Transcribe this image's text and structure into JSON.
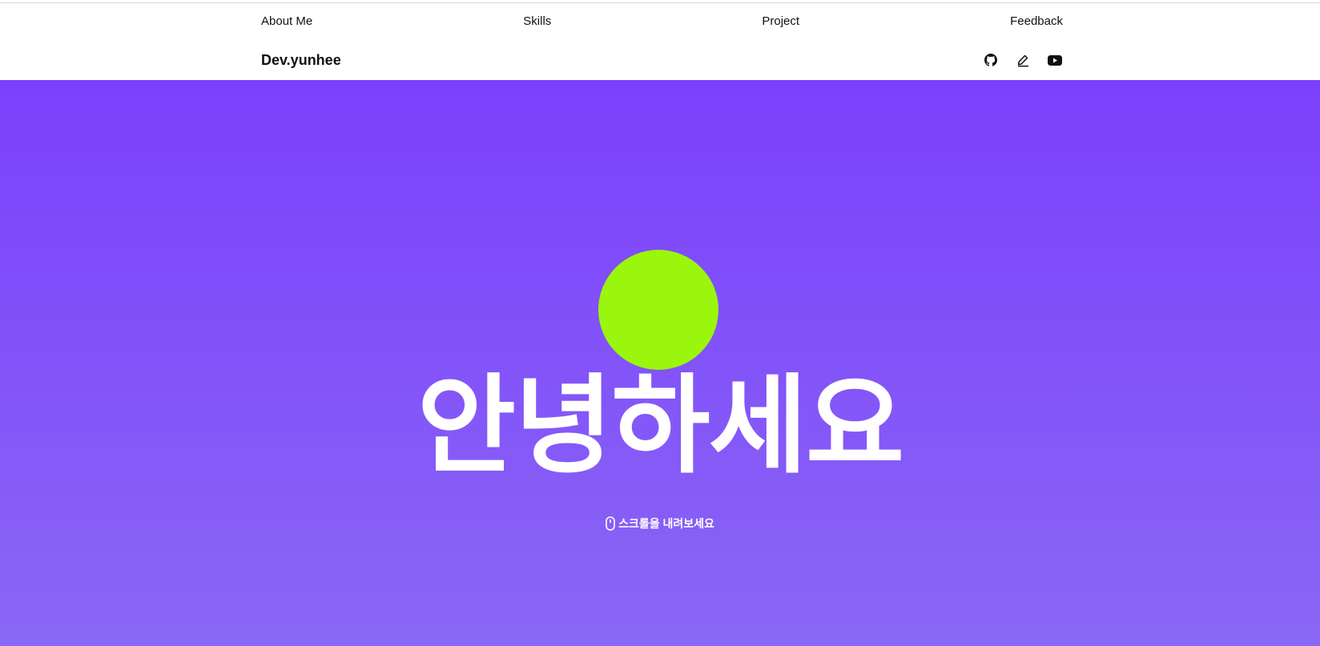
{
  "nav": {
    "items": [
      {
        "label": "About Me"
      },
      {
        "label": "Skills"
      },
      {
        "label": "Project"
      },
      {
        "label": "Feedback"
      }
    ]
  },
  "header": {
    "brand": "Dev.yunhee",
    "icons": [
      "github-icon",
      "pencil-icon",
      "youtube-icon"
    ]
  },
  "hero": {
    "greeting": "안녕하세요",
    "scroll_hint": "스크롤을 내려보세요",
    "gradient_top": "#7b40fc",
    "gradient_bottom": "#8a67f5",
    "circle_color": "#9af60c"
  }
}
